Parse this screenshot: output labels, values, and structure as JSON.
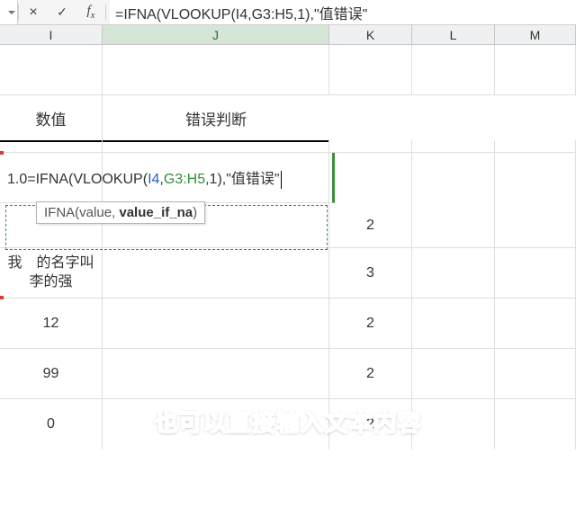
{
  "formula_bar": {
    "formula": "=IFNA(VLOOKUP(I4,G3:H5,1),\"值错误\""
  },
  "columns": {
    "I": "I",
    "J": "J",
    "K": "K",
    "L": "L",
    "M": "M"
  },
  "headers": {
    "I": "数值",
    "J": "错误判断"
  },
  "editing": {
    "prefix": "1.0",
    "eq": "=",
    "fn": "IFNA(VLOOKUP(",
    "ref1": "I4",
    "comma1": ",",
    "ref2": "G3:H5",
    "rest": ",1),\"值错误\""
  },
  "tooltip": {
    "fn": "IFNA",
    "open": "(",
    "arg1": "value",
    "sep": ", ",
    "arg2": "value_if_na",
    "close": ")"
  },
  "rows": [
    {
      "I": "",
      "J": "",
      "K": "2"
    },
    {
      "I": "我　的名字叫李的强",
      "J": "",
      "K": "3"
    },
    {
      "I": "12",
      "J": "",
      "K": "2"
    },
    {
      "I": "99",
      "J": "",
      "K": "2"
    },
    {
      "I": "0",
      "J": "",
      "K": "2"
    }
  ],
  "subtitle": "也可以直接输入文本内容"
}
